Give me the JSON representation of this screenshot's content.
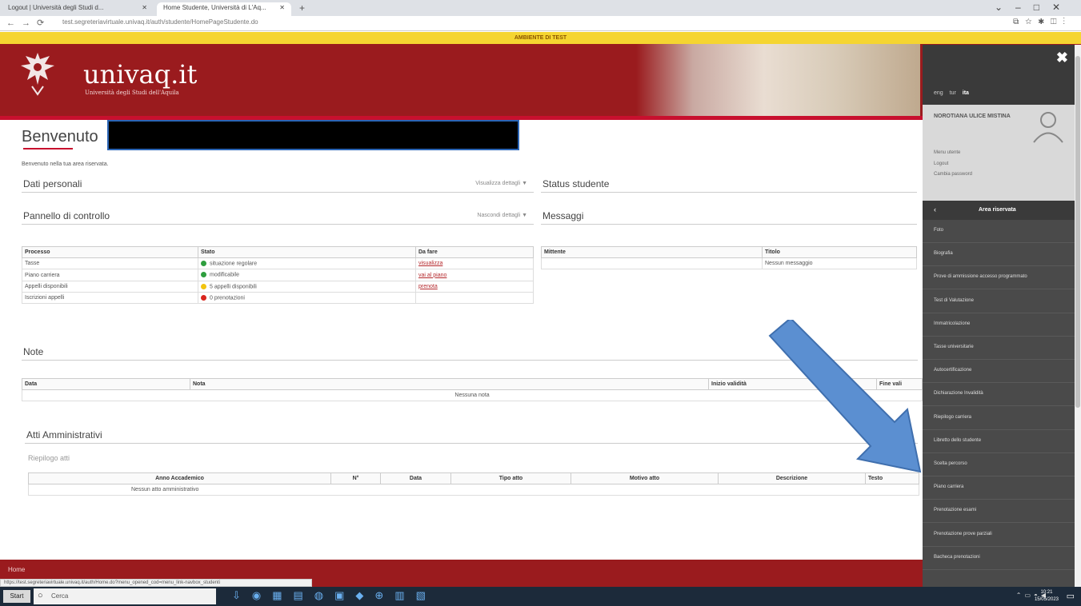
{
  "browser": {
    "tabs": [
      {
        "label": "Logout | Università degli Studi d..."
      },
      {
        "label": "Home Studente, Università di L'Aq..."
      }
    ],
    "new_tab": "+",
    "url": "test.segreteriavirtuale.univaq.it/auth/studente/HomePageStudente.do"
  },
  "banner": {
    "test_env": "AMBIENTE DI TEST"
  },
  "header": {
    "logo_text": "univaq.it",
    "logo_sub": "Università degli Studi dell'Aquila"
  },
  "main": {
    "welcome_title": "Benvenuto",
    "welcome_intro": "Benvenuto nella tua area riservata.",
    "sections": {
      "dati_personali": {
        "label": "Dati personali",
        "toggle": "Visualizza dettagli ▼"
      },
      "status_studente": {
        "label": "Status studente"
      },
      "pannello": {
        "label": "Pannello di controllo",
        "toggle": "Nascondi dettagli ▼"
      },
      "messaggi": {
        "label": "Messaggi"
      },
      "note": {
        "label": "Note"
      },
      "atti": {
        "label": "Atti Amministrativi",
        "sub": "Riepilogo atti"
      }
    },
    "pannello_table": {
      "headers": [
        "Processo",
        "Stato",
        "Da fare"
      ],
      "rows": [
        {
          "processo": "Tasse",
          "stato": "situazione regolare",
          "color": "#2e9e3e",
          "azione": "visualizza"
        },
        {
          "processo": "Piano carriera",
          "stato": "modificabile",
          "color": "#2e9e3e",
          "azione": "vai al piano"
        },
        {
          "processo": "Appelli disponibili",
          "stato": "5 appelli disponibili",
          "color": "#f2c40f",
          "azione": "prenota"
        },
        {
          "processo": "Iscrizioni appelli",
          "stato": "0 prenotazioni",
          "color": "#d9251d",
          "azione": ""
        }
      ]
    },
    "messaggi_table": {
      "headers": [
        "Mittente",
        "Titolo"
      ],
      "empty": "Nessun messaggio"
    },
    "note_table": {
      "headers": [
        "Data",
        "Nota",
        "Inizio validità",
        "Fine vali"
      ],
      "empty": "Nessuna nota"
    },
    "atti_table": {
      "headers": [
        "Anno Accademico",
        "N°",
        "Data",
        "Tipo atto",
        "Motivo atto",
        "Descrizione",
        "Testo"
      ],
      "empty": "Nessun atto amministrativo"
    }
  },
  "footer": {
    "home": "Home",
    "status_url": "https://test.segreteriavirtuale.univaq.it/auth/Home.do?menu_opened_cod=menu_link-navbox_studenti"
  },
  "sidemenu": {
    "close": "✖",
    "langs": [
      "eng",
      "tur",
      "ita"
    ],
    "user_name": "NOROTIANA ULICE MISTINA",
    "user_links": [
      "Menu utente",
      "Logout",
      "Cambia password"
    ],
    "area_label": "Area riservata",
    "items": [
      "Foto",
      "Biografia",
      "Prove di ammissione accesso programmato",
      "Test di Valutazione",
      "Immatricolazione",
      "Tasse universitarie",
      "Autocertificazione",
      "Dichiarazione Invalidità",
      "Riepilogo carriera",
      "Libretto dello studente",
      "Scelta percorso",
      "Piano carriera",
      "Prenotazione esami",
      "Prenotazione prove parziali",
      "Bacheca prenotazioni"
    ]
  },
  "taskbar": {
    "start": "Start",
    "search": "Cerca",
    "time": "10:21",
    "date": "15/05/2023"
  },
  "colors": {
    "header_red": "#9a1b1e",
    "accent_red": "#c8102e",
    "test_yellow": "#f5d531",
    "menu_dark": "#4a4a4a",
    "arrow_blue": "#5b8fd1"
  }
}
